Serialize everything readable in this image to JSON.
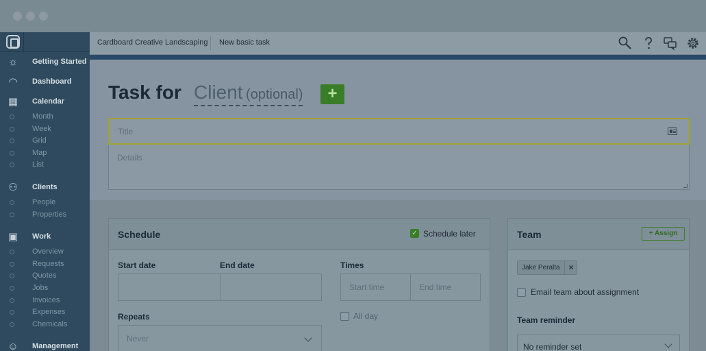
{
  "window": {
    "traffic_lights": [
      "close",
      "minimize",
      "maximize"
    ]
  },
  "sidebar": {
    "sections": [
      {
        "key": "getting_started",
        "label": "Getting Started",
        "icon": "sun-icon",
        "items": []
      },
      {
        "key": "dashboard",
        "label": "Dashboard",
        "icon": "gauge-icon",
        "items": []
      },
      {
        "key": "calendar",
        "label": "Calendar",
        "icon": "calendar-icon",
        "items": [
          "Month",
          "Week",
          "Grid",
          "Map",
          "List"
        ]
      },
      {
        "key": "clients",
        "label": "Clients",
        "icon": "people-icon",
        "items": [
          "People",
          "Properties"
        ]
      },
      {
        "key": "work",
        "label": "Work",
        "icon": "toolbox-icon",
        "items": [
          "Overview",
          "Requests",
          "Quotes",
          "Jobs",
          "Invoices",
          "Expenses",
          "Chemicals"
        ]
      },
      {
        "key": "management",
        "label": "Management",
        "icon": "head-icon",
        "items": []
      }
    ]
  },
  "topbar": {
    "company": "Cardboard Creative Landscaping",
    "page": "New basic task",
    "icons": [
      "search-icon",
      "help-icon",
      "chat-icon",
      "gear-icon"
    ]
  },
  "task": {
    "title_prefix": "Task for",
    "client_word": "Client",
    "client_optional": "(optional)",
    "add_client_symbol": "+",
    "title_placeholder": "Title",
    "details_placeholder": "Details"
  },
  "schedule": {
    "heading": "Schedule",
    "schedule_later_label": "Schedule later",
    "schedule_later_checked": true,
    "start_date_label": "Start date",
    "end_date_label": "End date",
    "times_label": "Times",
    "start_time_placeholder": "Start time",
    "end_time_placeholder": "End time",
    "all_day_label": "All day",
    "repeats_label": "Repeats",
    "repeats_value": "Never"
  },
  "team": {
    "heading": "Team",
    "assign_label": "+ Assign",
    "assignee": "Jake Peralta",
    "remove_symbol": "×",
    "email_label": "Email team about assignment",
    "reminder_label": "Team reminder",
    "reminder_value": "No reminder set"
  },
  "colors": {
    "sidebar_bg": "#2f4a5e",
    "accent_green": "#3a7d28",
    "accent_bar": "#2a4869",
    "overlay_tint": "#7f8e96"
  }
}
